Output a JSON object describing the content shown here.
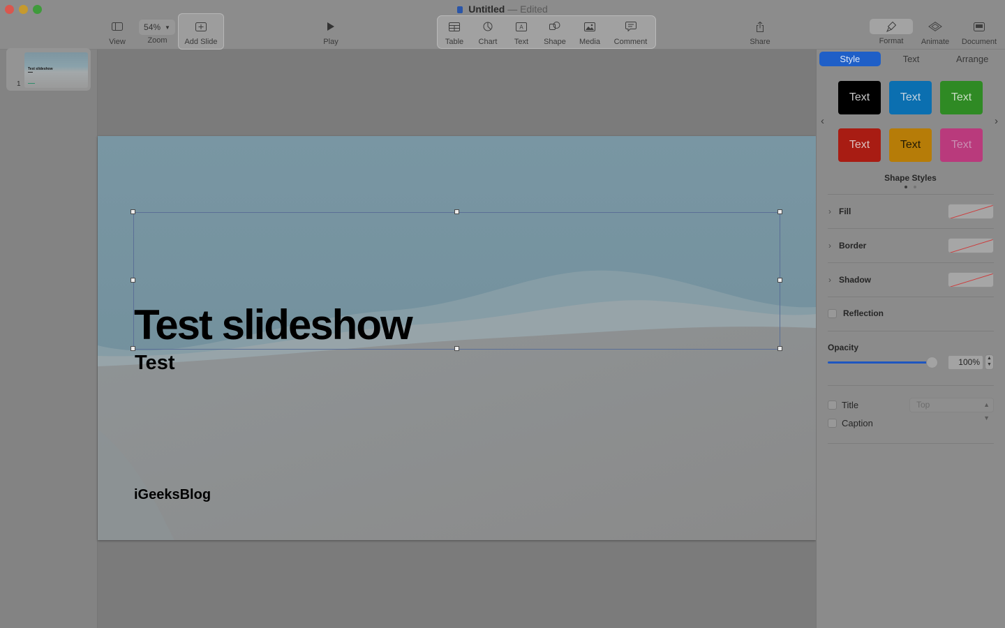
{
  "window": {
    "title": "Untitled",
    "separator": "—",
    "status": "Edited"
  },
  "toolbar": {
    "view": "View",
    "zoom_value": "54%",
    "zoom": "Zoom",
    "add_slide": "Add Slide",
    "play": "Play",
    "table": "Table",
    "chart": "Chart",
    "text": "Text",
    "shape": "Shape",
    "media": "Media",
    "comment": "Comment",
    "share": "Share",
    "format": "Format",
    "animate": "Animate",
    "document": "Document"
  },
  "navigator": {
    "slide_number": "1",
    "thumb_title": "Test slideshow"
  },
  "slide": {
    "title": "Test slideshow",
    "subtitle": "Test",
    "footer": "iGeeksBlog"
  },
  "inspector": {
    "tabs": [
      "Style",
      "Text",
      "Arrange"
    ],
    "active_tab": "Style",
    "swatches": [
      {
        "label": "Text",
        "bg": "#000000",
        "fg": "#c8c8c8"
      },
      {
        "label": "Text",
        "bg": "#0b6fb0",
        "fg": "#c4d3df"
      },
      {
        "label": "Text",
        "bg": "#2f8a24",
        "fg": "#c9dcc4"
      },
      {
        "label": "Text",
        "bg": "#a81c13",
        "fg": "#dcc3c1"
      },
      {
        "label": "Text",
        "bg": "#b67c08",
        "fg": "#231a05"
      },
      {
        "label": "Text",
        "bg": "#b93a7c",
        "fg": "#c98fb2"
      }
    ],
    "shape_styles_label": "Shape Styles",
    "fill": "Fill",
    "border": "Border",
    "shadow": "Shadow",
    "reflection": "Reflection",
    "opacity_label": "Opacity",
    "opacity_value": "100%",
    "opacity_level": 1.0,
    "title_label": "Title",
    "title_position": "Top",
    "caption_label": "Caption"
  },
  "colors": {
    "accent": "#1f5fc7",
    "selection": "#5a6e96"
  }
}
